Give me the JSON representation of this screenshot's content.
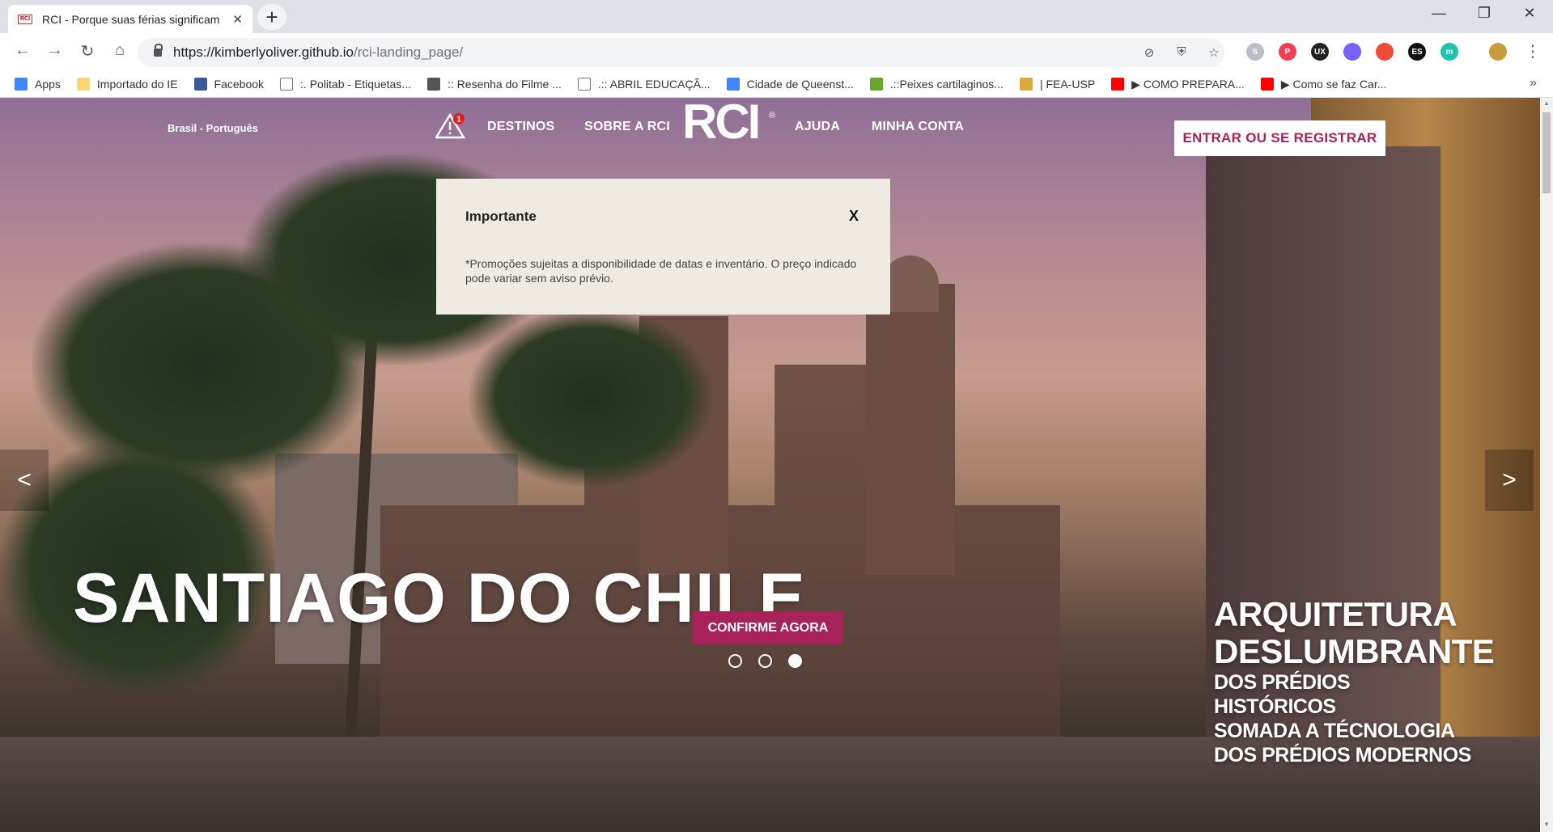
{
  "browser": {
    "tab_title": "RCI - Porque suas férias significam",
    "tab_favicon_text": "RCI",
    "url_host": "https://kimberlyoliver.github.io",
    "url_path": "/rci-landing_page/",
    "extensions": [
      {
        "name": "skype-ext",
        "label": "S",
        "color": "#b9c0c7"
      },
      {
        "name": "pocket-ext",
        "label": "P",
        "color": "#ef4056"
      },
      {
        "name": "ux-ext",
        "label": "UX",
        "color": "#222222"
      },
      {
        "name": "gradient-ext",
        "label": "",
        "color": "#7b61ff"
      },
      {
        "name": "red-ext",
        "label": "",
        "color": "#f04b3a"
      },
      {
        "name": "es-ext",
        "label": "ES",
        "color": "#111111"
      },
      {
        "name": "teal-ext",
        "label": "m",
        "color": "#20c0b0"
      }
    ]
  },
  "bookmarks": [
    {
      "label": "Apps",
      "icon": "apps-grid-icon",
      "color": "#4285f4"
    },
    {
      "label": "Importado do IE",
      "icon": "folder-icon",
      "color": "#f7d774"
    },
    {
      "label": "Facebook",
      "icon": "facebook-icon",
      "color": "#3b5998"
    },
    {
      "label": ":. Politab - Etiquetas...",
      "icon": "page-icon",
      "color": "#ffffff"
    },
    {
      "label": ":: Resenha do Filme ...",
      "icon": "dvd-icon",
      "color": "#555555"
    },
    {
      "label": ".:: ABRIL EDUCAÇÃ...",
      "icon": "page-icon",
      "color": "#ffffff"
    },
    {
      "label": "Cidade de Queenst...",
      "icon": "google-icon",
      "color": "#4285f4"
    },
    {
      "label": ".::Peixes cartilaginos...",
      "icon": "leaf-icon",
      "color": "#6aa52f"
    },
    {
      "label": "| FEA-USP",
      "icon": "fea-icon",
      "color": "#d9a93a"
    },
    {
      "label": "▶ COMO PREPARA...",
      "icon": "youtube-icon",
      "color": "#ff0000"
    },
    {
      "label": "▶ Como se faz Car...",
      "icon": "youtube-icon",
      "color": "#ff0000"
    }
  ],
  "header": {
    "language": "Brasil - Português",
    "alert_count": "1",
    "nav": {
      "destinos": "DESTINOS",
      "sobre": "SOBRE A RCI",
      "logo": "RCI",
      "logo_mark": "®",
      "ajuda": "AJUDA",
      "conta": "MINHA CONTA"
    },
    "login_label": "ENTRAR OU SE REGISTRAR"
  },
  "modal": {
    "title": "Importante",
    "close_label": "X",
    "body": "*Promoções sujeitas a disponibilidade de datas e inventário. O preço indicado pode variar sem aviso prévio."
  },
  "hero": {
    "prev": "<",
    "next": ">",
    "title": "SANTIAGO DO CHILE",
    "cta": "CONFIRME AGORA",
    "side_line1": "ARQUITETURA",
    "side_line2": "DESLUMBRANTE",
    "side_line3": "DOS PRÉDIOS HISTÓRICOS",
    "side_line4": "SOMADA A TÉCNOLOGIA",
    "side_line5": "DOS PRÉDIOS MODERNOS",
    "slides": 3,
    "active_slide": 3
  },
  "colors": {
    "brand": "#a8225a",
    "modal_bg": "#efebe3"
  }
}
